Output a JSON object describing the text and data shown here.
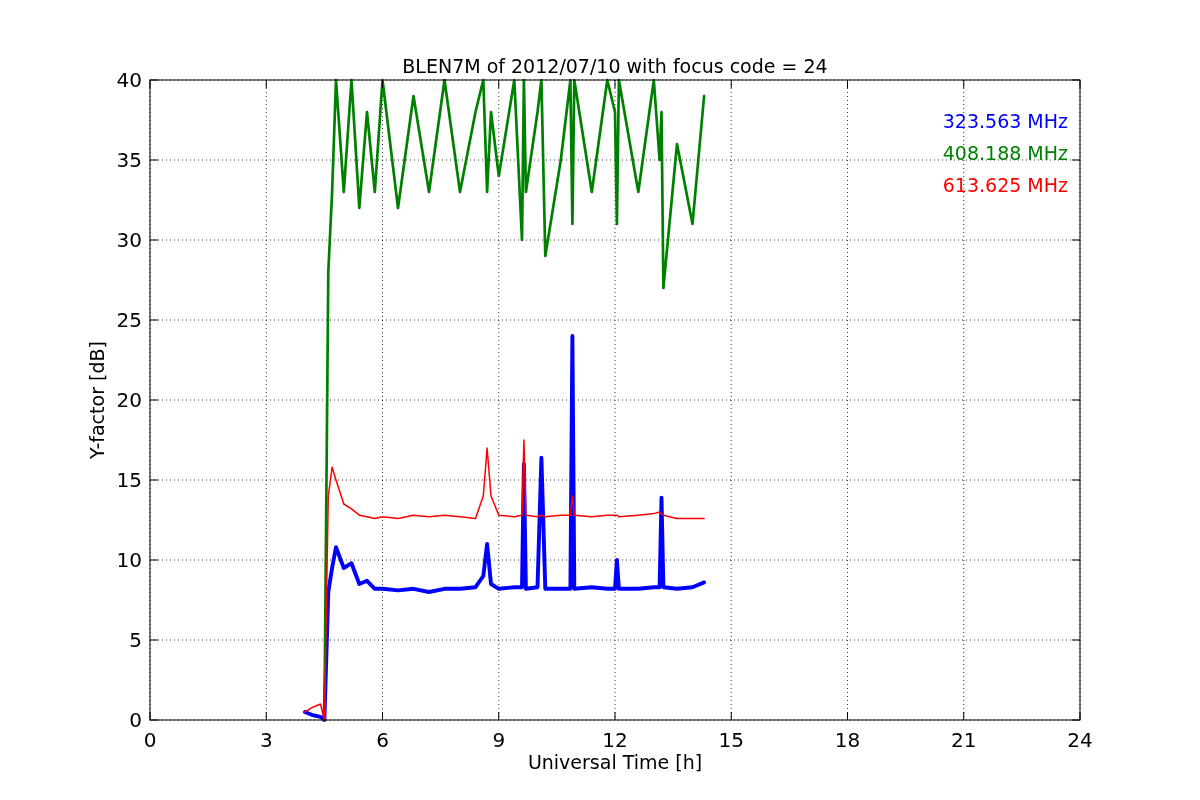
{
  "chart_data": {
    "type": "line",
    "title": "BLEN7M of 2012/07/10 with focus code = 24",
    "xlabel": "Universal Time [h]",
    "ylabel": "Y-factor [dB]",
    "x": [
      4.0,
      4.2,
      4.4,
      4.5,
      4.6,
      4.7,
      4.8,
      5.0,
      5.2,
      5.4,
      5.6,
      5.8,
      6.0,
      6.4,
      6.8,
      7.2,
      7.6,
      8.0,
      8.4,
      8.6,
      8.7,
      8.8,
      9.0,
      9.4,
      9.6,
      9.65,
      9.7,
      10.0,
      10.1,
      10.2,
      10.6,
      10.85,
      10.9,
      10.95,
      11.4,
      11.8,
      12.0,
      12.05,
      12.1,
      12.6,
      13.0,
      13.15,
      13.2,
      13.25,
      13.6,
      14.0,
      14.3
    ],
    "series": [
      {
        "name": "323.563 MHz",
        "color": "#0000ff",
        "values": [
          0.5,
          0.3,
          0.2,
          0,
          8,
          9.5,
          10.8,
          9.5,
          9.8,
          8.5,
          8.7,
          8.2,
          8.2,
          8.1,
          8.2,
          8.0,
          8.2,
          8.2,
          8.3,
          9.0,
          11,
          8.5,
          8.2,
          8.3,
          8.3,
          16,
          8.2,
          8.3,
          16.4,
          8.2,
          8.2,
          8.2,
          24,
          8.2,
          8.3,
          8.2,
          8.2,
          10,
          8.2,
          8.2,
          8.3,
          8.3,
          13.9,
          8.3,
          8.2,
          8.3,
          8.6
        ]
      },
      {
        "name": "408.188 MHz",
        "color": "#008000",
        "values": [
          null,
          null,
          null,
          0,
          28,
          33,
          40,
          33,
          40,
          32,
          38,
          33,
          40,
          32,
          39,
          33,
          40,
          33,
          38,
          40,
          33,
          38,
          34,
          40,
          30,
          40,
          33,
          38,
          40,
          29,
          35,
          40,
          31,
          40,
          33,
          40,
          38,
          31,
          40,
          33,
          40,
          35,
          38,
          27,
          36,
          31,
          39
        ]
      },
      {
        "name": "613.625 MHz",
        "color": "#ff0000",
        "values": [
          0.5,
          0.8,
          1,
          0,
          14,
          15.8,
          15,
          13.5,
          13.2,
          12.8,
          12.7,
          12.6,
          12.7,
          12.6,
          12.8,
          12.7,
          12.8,
          12.7,
          12.6,
          14,
          17,
          14,
          12.8,
          12.7,
          12.8,
          17.5,
          12.8,
          12.7,
          12.8,
          12.7,
          12.8,
          12.8,
          14,
          12.8,
          12.7,
          12.8,
          12.8,
          12.8,
          12.7,
          12.8,
          12.9,
          13,
          12.9,
          12.8,
          12.6,
          12.6,
          12.6
        ]
      }
    ],
    "xlim": [
      0,
      24
    ],
    "ylim": [
      0,
      40
    ],
    "xticks": [
      0,
      3,
      6,
      9,
      12,
      15,
      18,
      21,
      24
    ],
    "yticks": [
      0,
      5,
      10,
      15,
      20,
      25,
      30,
      35,
      40
    ],
    "grid": true
  }
}
